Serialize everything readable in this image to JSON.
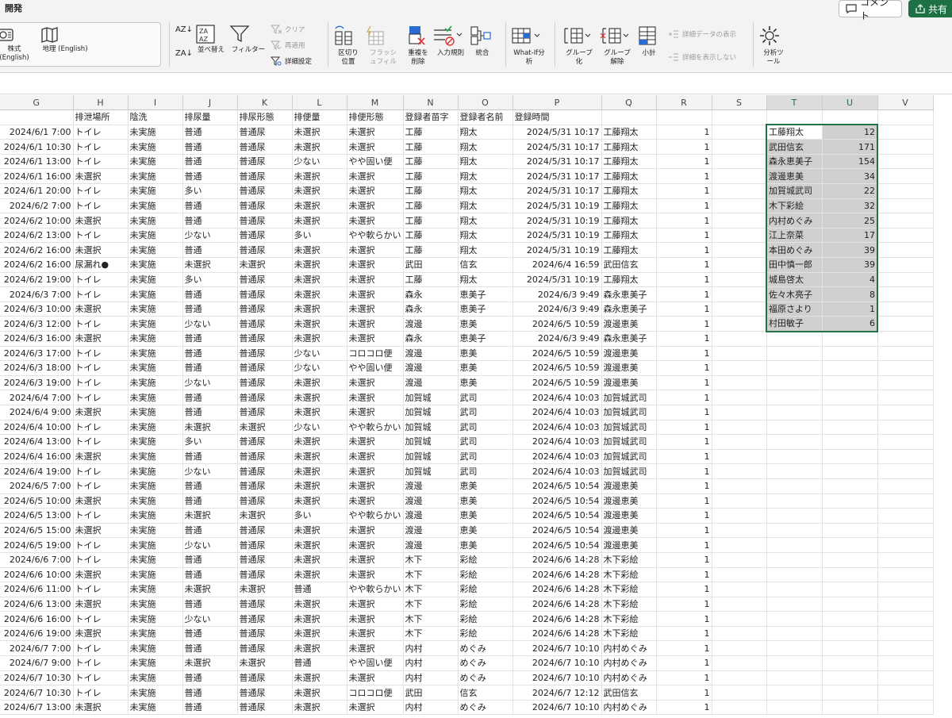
{
  "ribbon": {
    "tab_title": "開発",
    "comment_label": "コメント",
    "share_label": "共有",
    "datatype_stocks": "株式 (English)",
    "datatype_geo": "地理 (English)",
    "sort_az": "AZ↓",
    "sort_za": "ZA↓",
    "sort_label": "並べ替え",
    "filter_label": "フィルター",
    "clear_label": "クリア",
    "reapply_label": "再適用",
    "advanced_label": "詳細設定",
    "text_to_columns": "区切り位置",
    "flash_fill": "フラッシュフィル",
    "remove_duplicates": "重複を削除",
    "data_validation": "入力規則",
    "consolidate": "統合",
    "whatif": "What-If分析",
    "group": "グループ化",
    "ungroup": "グループ解除",
    "subtotal": "小計",
    "show_detail": "詳細データの表示",
    "hide_detail": "詳細を表示しない",
    "analysis_tools": "分析ツール"
  },
  "columns": [
    "G",
    "H",
    "I",
    "J",
    "K",
    "L",
    "M",
    "N",
    "O",
    "P",
    "Q",
    "R",
    "S",
    "T",
    "U",
    "V"
  ],
  "header_row": [
    "",
    "排泄場所",
    "陰洗",
    "排尿量",
    "排尿形態",
    "排便量",
    "排便形態",
    "登録者苗字",
    "登録者名前",
    "登録時間",
    "",
    "",
    "",
    "",
    "",
    ""
  ],
  "rows": [
    [
      "2024/6/1 7:00",
      "トイレ",
      "未実施",
      "普通",
      "普通尿",
      "未選択",
      "未選択",
      "工藤",
      "翔太",
      "2024/5/31 10:17",
      "工藤翔太",
      "1",
      "",
      "工藤翔太",
      "12"
    ],
    [
      "2024/6/1 10:30",
      "トイレ",
      "未実施",
      "普通",
      "普通尿",
      "未選択",
      "未選択",
      "工藤",
      "翔太",
      "2024/5/31 10:17",
      "工藤翔太",
      "1",
      "",
      "武田信玄",
      "171"
    ],
    [
      "2024/6/1 13:00",
      "トイレ",
      "未実施",
      "普通",
      "普通尿",
      "少ない",
      "やや固い便",
      "工藤",
      "翔太",
      "2024/5/31 10:17",
      "工藤翔太",
      "1",
      "",
      "森永恵美子",
      "154"
    ],
    [
      "2024/6/1 16:00",
      "未選択",
      "未実施",
      "普通",
      "普通尿",
      "未選択",
      "未選択",
      "工藤",
      "翔太",
      "2024/5/31 10:17",
      "工藤翔太",
      "1",
      "",
      "渡邊恵美",
      "34"
    ],
    [
      "2024/6/1 20:00",
      "トイレ",
      "未実施",
      "多い",
      "普通尿",
      "未選択",
      "未選択",
      "工藤",
      "翔太",
      "2024/5/31 10:17",
      "工藤翔太",
      "1",
      "",
      "加賀城武司",
      "22"
    ],
    [
      "2024/6/2 7:00",
      "トイレ",
      "未実施",
      "普通",
      "普通尿",
      "未選択",
      "未選択",
      "工藤",
      "翔太",
      "2024/5/31 10:19",
      "工藤翔太",
      "1",
      "",
      "木下彩絵",
      "32"
    ],
    [
      "2024/6/2 10:00",
      "未選択",
      "未実施",
      "普通",
      "普通尿",
      "未選択",
      "未選択",
      "工藤",
      "翔太",
      "2024/5/31 10:19",
      "工藤翔太",
      "1",
      "",
      "内村めぐみ",
      "25"
    ],
    [
      "2024/6/2 13:00",
      "トイレ",
      "未実施",
      "少ない",
      "普通尿",
      "多い",
      "やや軟らかい",
      "工藤",
      "翔太",
      "2024/5/31 10:19",
      "工藤翔太",
      "1",
      "",
      "江上奈菜",
      "17"
    ],
    [
      "2024/6/2 16:00",
      "未選択",
      "未実施",
      "普通",
      "普通尿",
      "未選択",
      "未選択",
      "工藤",
      "翔太",
      "2024/5/31 10:19",
      "工藤翔太",
      "1",
      "",
      "本田めぐみ",
      "39"
    ],
    [
      "2024/6/2 16:00",
      "尿漏れ●",
      "未実施",
      "未選択",
      "未選択",
      "未選択",
      "未選択",
      "武田",
      "信玄",
      "2024/6/4 16:59",
      "武田信玄",
      "1",
      "",
      "田中慎一郎",
      "39"
    ],
    [
      "2024/6/2 19:00",
      "トイレ",
      "未実施",
      "多い",
      "普通尿",
      "未選択",
      "未選択",
      "工藤",
      "翔太",
      "2024/5/31 10:19",
      "工藤翔太",
      "1",
      "",
      "城島啓太",
      "4"
    ],
    [
      "2024/6/3 7:00",
      "トイレ",
      "未実施",
      "普通",
      "普通尿",
      "未選択",
      "未選択",
      "森永",
      "恵美子",
      "2024/6/3 9:49",
      "森永恵美子",
      "1",
      "",
      "佐々木亮子",
      "8"
    ],
    [
      "2024/6/3 10:00",
      "未選択",
      "未実施",
      "普通",
      "普通尿",
      "未選択",
      "未選択",
      "森永",
      "恵美子",
      "2024/6/3 9:49",
      "森永恵美子",
      "1",
      "",
      "福原さより",
      "1"
    ],
    [
      "2024/6/3 12:00",
      "トイレ",
      "未実施",
      "少ない",
      "普通尿",
      "未選択",
      "未選択",
      "渡邊",
      "恵美",
      "2024/6/5 10:59",
      "渡邊恵美",
      "1",
      "",
      "村田敏子",
      "6"
    ],
    [
      "2024/6/3 16:00",
      "未選択",
      "未実施",
      "普通",
      "普通尿",
      "未選択",
      "未選択",
      "森永",
      "恵美子",
      "2024/6/3 9:49",
      "森永恵美子",
      "1",
      "",
      "",
      ""
    ],
    [
      "2024/6/3 17:00",
      "トイレ",
      "未実施",
      "普通",
      "普通尿",
      "少ない",
      "コロコロ便",
      "渡邊",
      "恵美",
      "2024/6/5 10:59",
      "渡邊恵美",
      "1",
      "",
      "",
      ""
    ],
    [
      "2024/6/3 18:00",
      "トイレ",
      "未実施",
      "普通",
      "普通尿",
      "少ない",
      "やや固い便",
      "渡邊",
      "恵美",
      "2024/6/5 10:59",
      "渡邊恵美",
      "1",
      "",
      "",
      ""
    ],
    [
      "2024/6/3 19:00",
      "トイレ",
      "未実施",
      "少ない",
      "普通尿",
      "未選択",
      "未選択",
      "渡邊",
      "恵美",
      "2024/6/5 10:59",
      "渡邊恵美",
      "1",
      "",
      "",
      ""
    ],
    [
      "2024/6/4 7:00",
      "トイレ",
      "未実施",
      "普通",
      "普通尿",
      "未選択",
      "未選択",
      "加賀城",
      "武司",
      "2024/6/4 10:03",
      "加賀城武司",
      "1",
      "",
      "",
      ""
    ],
    [
      "2024/6/4 9:00",
      "未選択",
      "未実施",
      "普通",
      "普通尿",
      "未選択",
      "未選択",
      "加賀城",
      "武司",
      "2024/6/4 10:03",
      "加賀城武司",
      "1",
      "",
      "",
      ""
    ],
    [
      "2024/6/4 10:00",
      "トイレ",
      "未実施",
      "未選択",
      "未選択",
      "少ない",
      "やや軟らかい",
      "加賀城",
      "武司",
      "2024/6/4 10:03",
      "加賀城武司",
      "1",
      "",
      "",
      ""
    ],
    [
      "2024/6/4 13:00",
      "トイレ",
      "未実施",
      "多い",
      "普通尿",
      "未選択",
      "未選択",
      "加賀城",
      "武司",
      "2024/6/4 10:03",
      "加賀城武司",
      "1",
      "",
      "",
      ""
    ],
    [
      "2024/6/4 16:00",
      "未選択",
      "未実施",
      "普通",
      "普通尿",
      "未選択",
      "未選択",
      "加賀城",
      "武司",
      "2024/6/4 10:03",
      "加賀城武司",
      "1",
      "",
      "",
      ""
    ],
    [
      "2024/6/4 19:00",
      "トイレ",
      "未実施",
      "少ない",
      "普通尿",
      "未選択",
      "未選択",
      "加賀城",
      "武司",
      "2024/6/4 10:03",
      "加賀城武司",
      "1",
      "",
      "",
      ""
    ],
    [
      "2024/6/5 7:00",
      "トイレ",
      "未実施",
      "普通",
      "普通尿",
      "未選択",
      "未選択",
      "渡邊",
      "恵美",
      "2024/6/5 10:54",
      "渡邊恵美",
      "1",
      "",
      "",
      ""
    ],
    [
      "2024/6/5 10:00",
      "未選択",
      "未実施",
      "普通",
      "普通尿",
      "未選択",
      "未選択",
      "渡邊",
      "恵美",
      "2024/6/5 10:54",
      "渡邊恵美",
      "1",
      "",
      "",
      ""
    ],
    [
      "2024/6/5 13:00",
      "トイレ",
      "未実施",
      "未選択",
      "未選択",
      "多い",
      "やや軟らかい",
      "渡邊",
      "恵美",
      "2024/6/5 10:54",
      "渡邊恵美",
      "1",
      "",
      "",
      ""
    ],
    [
      "2024/6/5 15:00",
      "未選択",
      "未実施",
      "普通",
      "普通尿",
      "未選択",
      "未選択",
      "渡邊",
      "恵美",
      "2024/6/5 10:54",
      "渡邊恵美",
      "1",
      "",
      "",
      ""
    ],
    [
      "2024/6/5 19:00",
      "トイレ",
      "未実施",
      "少ない",
      "普通尿",
      "未選択",
      "未選択",
      "渡邊",
      "恵美",
      "2024/6/5 10:54",
      "渡邊恵美",
      "1",
      "",
      "",
      ""
    ],
    [
      "2024/6/6 7:00",
      "トイレ",
      "未実施",
      "普通",
      "普通尿",
      "未選択",
      "未選択",
      "木下",
      "彩絵",
      "2024/6/6 14:28",
      "木下彩絵",
      "1",
      "",
      "",
      ""
    ],
    [
      "2024/6/6 10:00",
      "未選択",
      "未実施",
      "普通",
      "普通尿",
      "未選択",
      "未選択",
      "木下",
      "彩絵",
      "2024/6/6 14:28",
      "木下彩絵",
      "1",
      "",
      "",
      ""
    ],
    [
      "2024/6/6 11:00",
      "トイレ",
      "未実施",
      "未選択",
      "未選択",
      "普通",
      "やや軟らかい",
      "木下",
      "彩絵",
      "2024/6/6 14:28",
      "木下彩絵",
      "1",
      "",
      "",
      ""
    ],
    [
      "2024/6/6 13:00",
      "未選択",
      "未実施",
      "普通",
      "普通尿",
      "未選択",
      "未選択",
      "木下",
      "彩絵",
      "2024/6/6 14:28",
      "木下彩絵",
      "1",
      "",
      "",
      ""
    ],
    [
      "2024/6/6 16:00",
      "トイレ",
      "未実施",
      "少ない",
      "普通尿",
      "未選択",
      "未選択",
      "木下",
      "彩絵",
      "2024/6/6 14:28",
      "木下彩絵",
      "1",
      "",
      "",
      ""
    ],
    [
      "2024/6/6 19:00",
      "未選択",
      "未実施",
      "普通",
      "普通尿",
      "未選択",
      "未選択",
      "木下",
      "彩絵",
      "2024/6/6 14:28",
      "木下彩絵",
      "1",
      "",
      "",
      ""
    ],
    [
      "2024/6/7 7:00",
      "トイレ",
      "未実施",
      "普通",
      "普通尿",
      "未選択",
      "未選択",
      "内村",
      "めぐみ",
      "2024/6/7 10:10",
      "内村めぐみ",
      "1",
      "",
      "",
      ""
    ],
    [
      "2024/6/7 9:00",
      "トイレ",
      "未実施",
      "未選択",
      "未選択",
      "普通",
      "やや固い便",
      "内村",
      "めぐみ",
      "2024/6/7 10:10",
      "内村めぐみ",
      "1",
      "",
      "",
      ""
    ],
    [
      "2024/6/7 10:30",
      "トイレ",
      "未実施",
      "普通",
      "普通尿",
      "未選択",
      "未選択",
      "内村",
      "めぐみ",
      "2024/6/7 10:10",
      "内村めぐみ",
      "1",
      "",
      "",
      ""
    ],
    [
      "2024/6/7 10:30",
      "トイレ",
      "未実施",
      "普通",
      "普通尿",
      "未選択",
      "コロコロ便",
      "武田",
      "信玄",
      "2024/6/7 12:12",
      "武田信玄",
      "1",
      "",
      "",
      ""
    ],
    [
      "2024/6/7 13:00",
      "未選択",
      "未実施",
      "普通",
      "普通尿",
      "未選択",
      "未選択",
      "内村",
      "めぐみ",
      "2024/6/7 10:10",
      "内村めぐみ",
      "1",
      "",
      "",
      ""
    ]
  ],
  "colors": {
    "accent": "#217346",
    "share_bg": "#1e7145",
    "selection_fill": "#cfcfcf"
  }
}
